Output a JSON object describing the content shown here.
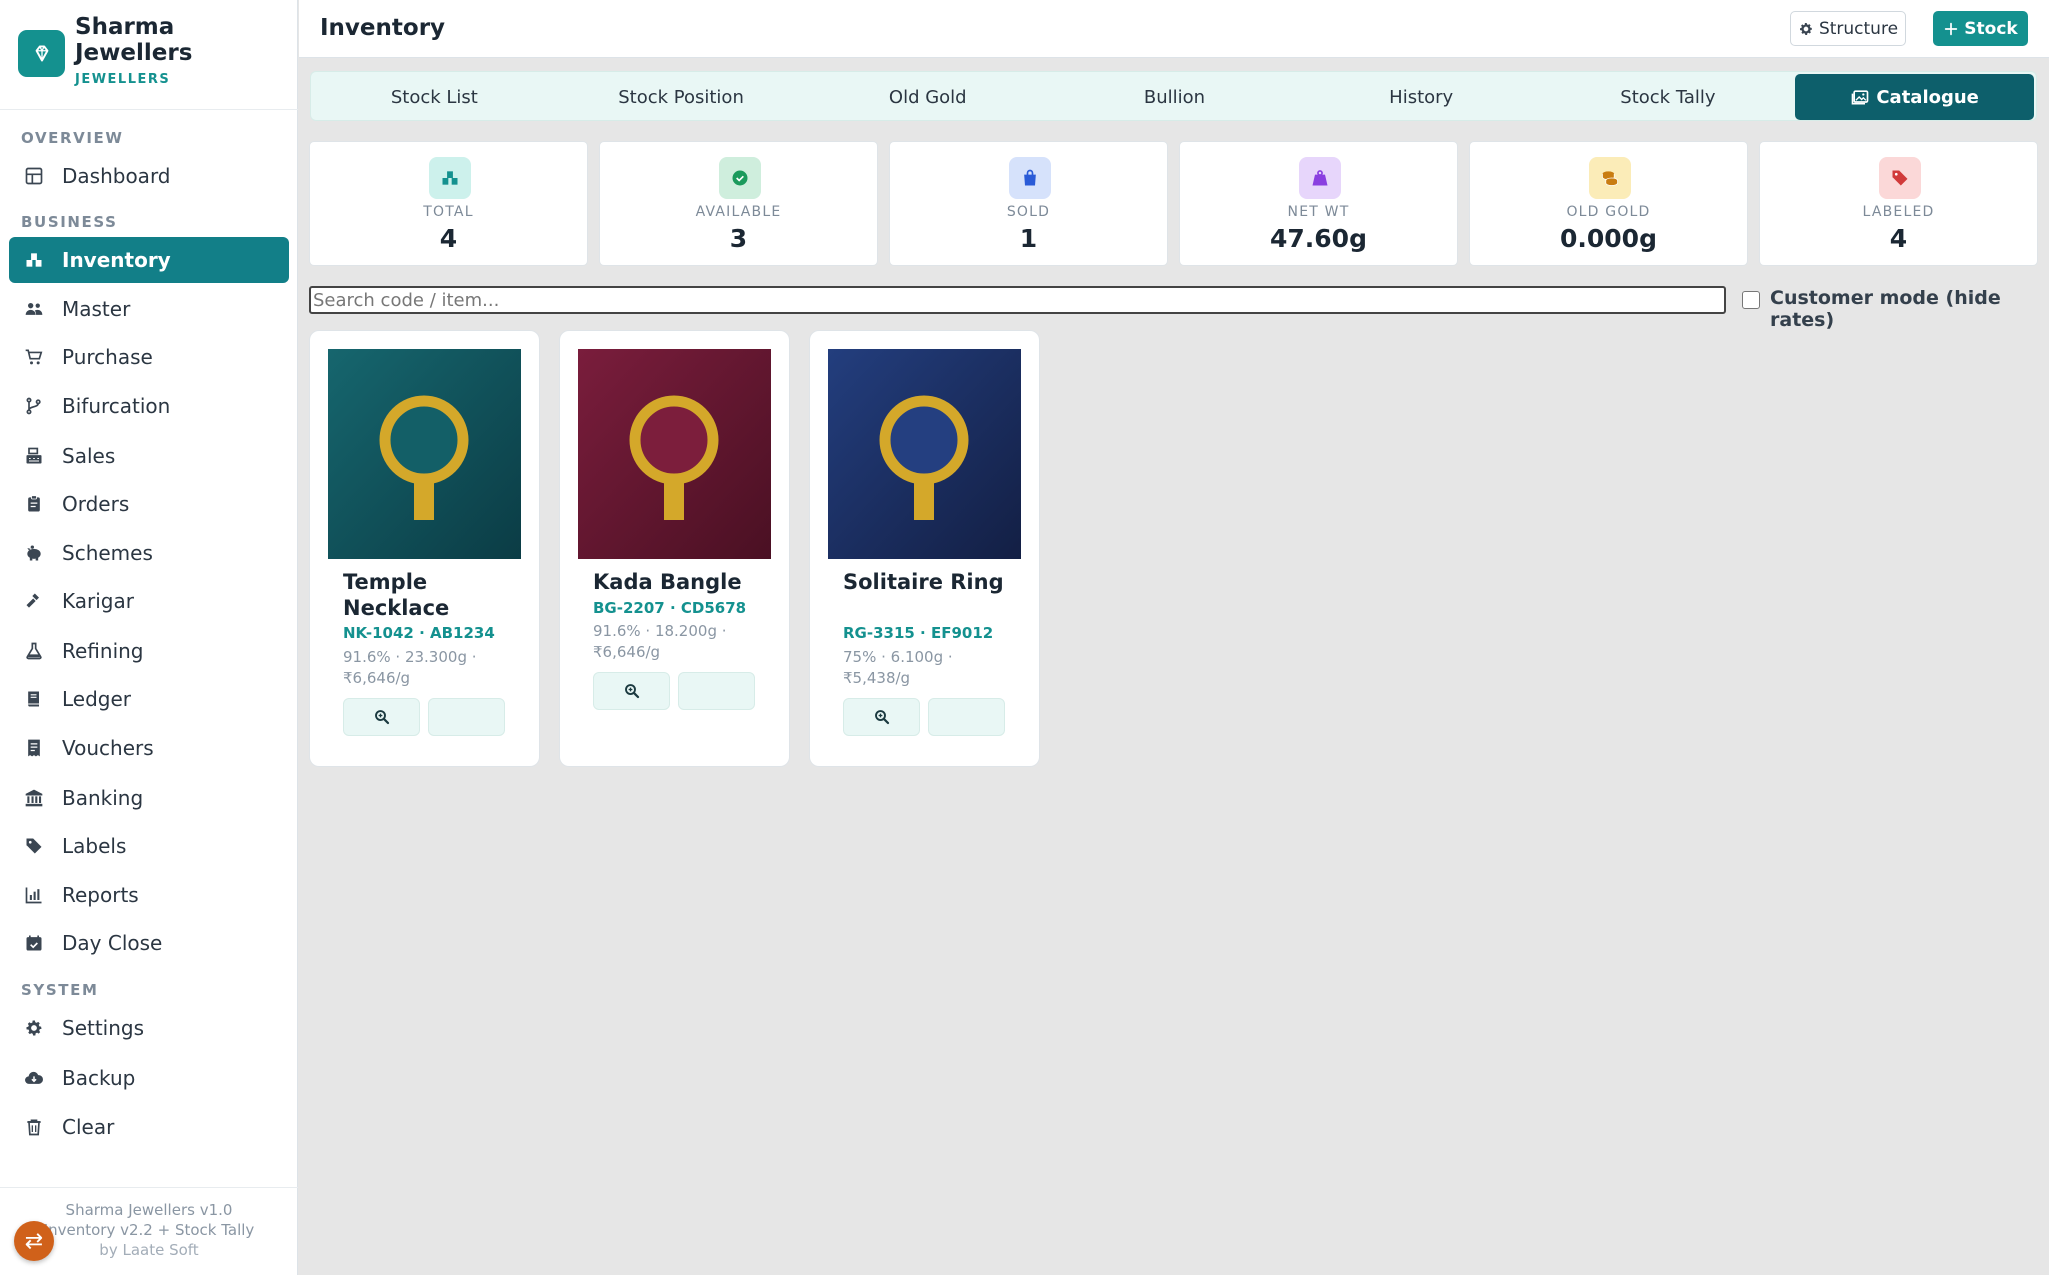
{
  "brand": {
    "name": "Sharma Jewellers",
    "subtitle": "JEWELLERS"
  },
  "sidebar": {
    "sections": [
      "OVERVIEW",
      "BUSINESS",
      "SYSTEM"
    ],
    "items": [
      {
        "label": "Dashboard",
        "icon": "dashboard-icon"
      },
      {
        "label": "Inventory",
        "icon": "inventory-icon",
        "active": true
      },
      {
        "label": "Master",
        "icon": "users-icon"
      },
      {
        "label": "Purchase",
        "icon": "cart-icon"
      },
      {
        "label": "Bifurcation",
        "icon": "branch-icon"
      },
      {
        "label": "Sales",
        "icon": "cash-register-icon"
      },
      {
        "label": "Orders",
        "icon": "clipboard-icon"
      },
      {
        "label": "Schemes",
        "icon": "piggy-bank-icon"
      },
      {
        "label": "Karigar",
        "icon": "hammer-icon"
      },
      {
        "label": "Refining",
        "icon": "flask-icon"
      },
      {
        "label": "Ledger",
        "icon": "book-icon"
      },
      {
        "label": "Vouchers",
        "icon": "receipt-icon"
      },
      {
        "label": "Banking",
        "icon": "bank-icon"
      },
      {
        "label": "Labels",
        "icon": "tags-icon"
      },
      {
        "label": "Reports",
        "icon": "chart-icon"
      },
      {
        "label": "Day Close",
        "icon": "calendar-check-icon"
      },
      {
        "label": "Settings",
        "icon": "gear-icon"
      },
      {
        "label": "Backup",
        "icon": "cloud-download-icon"
      },
      {
        "label": "Clear",
        "icon": "trash-icon"
      }
    ],
    "footer": [
      "Sharma Jewellers v1.0",
      "Inventory v2.2 + Stock Tally",
      "by Laate Soft"
    ]
  },
  "header": {
    "title": "Inventory",
    "structure_label": "Structure",
    "stock_label": "Stock"
  },
  "tabs": [
    {
      "label": "Stock List"
    },
    {
      "label": "Stock Position"
    },
    {
      "label": "Old Gold"
    },
    {
      "label": "Bullion"
    },
    {
      "label": "History"
    },
    {
      "label": "Stock Tally"
    },
    {
      "label": "Catalogue",
      "active": true
    }
  ],
  "stats": [
    {
      "label": "TOTAL",
      "value": "4",
      "icon": "boxes-icon",
      "bg": "#cdf1ec",
      "fg": "#14918f"
    },
    {
      "label": "AVAILABLE",
      "value": "3",
      "icon": "check-circle-icon",
      "bg": "#cfeedd",
      "fg": "#1b9a5c"
    },
    {
      "label": "SOLD",
      "value": "1",
      "icon": "shopping-bag-icon",
      "bg": "#d6e2fb",
      "fg": "#2a5bd7"
    },
    {
      "label": "NET WT",
      "value": "47.60g",
      "icon": "weight-icon",
      "bg": "#e7d6fb",
      "fg": "#8a3fe0"
    },
    {
      "label": "OLD GOLD",
      "value": "0.000g",
      "icon": "coins-icon",
      "bg": "#fbecb8",
      "fg": "#c97d12"
    },
    {
      "label": "LABELED",
      "value": "4",
      "icon": "tag-icon",
      "bg": "#fbd8d8",
      "fg": "#d13a3a"
    }
  ],
  "search": {
    "placeholder": "Search code / item..."
  },
  "customer_mode": {
    "label": "Customer mode (hide rates)",
    "checked": false
  },
  "products": [
    {
      "name": "Temple Necklace",
      "code": "NK-1042 · AB1234",
      "purity_weight": "91.6% · 23.300g ·",
      "rate": "₹6,646/g",
      "color_top": "#16666e",
      "color_bottom": "#0b3c45",
      "inner": "#135f67"
    },
    {
      "name": "Kada Bangle",
      "code": "BG-2207 · CD5678",
      "purity_weight": "91.6% · 18.200g ·",
      "rate": "₹6,646/g",
      "color_top": "#7a1d3c",
      "color_bottom": "#4a1023",
      "inner": "#7c1e3c"
    },
    {
      "name": "Solitaire Ring",
      "code": "RG-3315 · EF9012",
      "purity_weight": "75% · 6.100g ·",
      "rate": "₹5,438/g",
      "color_top": "#233e7e",
      "color_bottom": "#131f44",
      "inner": "#243f80"
    }
  ],
  "colors": {
    "accent": "#14918f",
    "accent_dark": "#0d5f6b",
    "gold": "#d4a82a"
  }
}
